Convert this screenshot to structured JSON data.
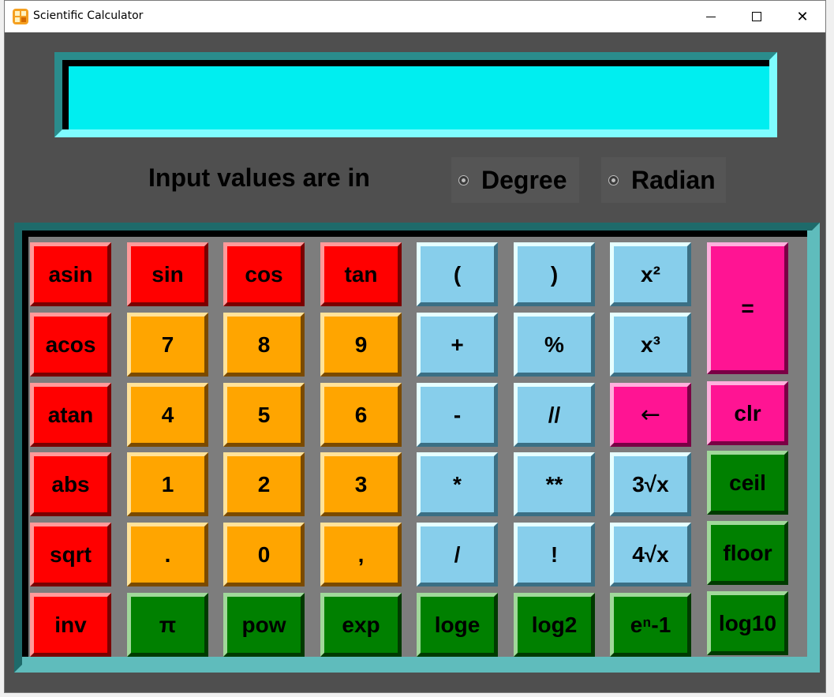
{
  "window": {
    "title": "Scientific Calculator"
  },
  "titlebar": {
    "min_icon": "minimize-icon",
    "max_icon": "maximize-icon",
    "close_glyph": "✕"
  },
  "display": {
    "value": ""
  },
  "mode": {
    "label": "Input values are in",
    "options": [
      "Degree",
      "Radian"
    ],
    "selected": null
  },
  "colors": {
    "red": "#ff0000",
    "orange": "#ffa500",
    "blue": "#87ceeb",
    "pink": "#ff1493",
    "green": "#008000",
    "display": "#00eef0",
    "background": "#4f4f4f"
  },
  "keys": {
    "asin": "asin",
    "sin": "sin",
    "cos": "cos",
    "tan": "tan",
    "lparen": "(",
    "rparen": ")",
    "square": "x²",
    "equals": "=",
    "acos": "acos",
    "n7": "7",
    "n8": "8",
    "n9": "9",
    "plus": "+",
    "percent": "%",
    "cube": "x³",
    "atan": "atan",
    "n4": "4",
    "n5": "5",
    "n6": "6",
    "minus": "-",
    "floordiv": "//",
    "backspace": "←",
    "clear": "clr",
    "abs": "abs",
    "n1": "1",
    "n2": "2",
    "n3": "3",
    "multiply": "*",
    "power_op": "**",
    "cube_root": "3√x",
    "ceil": "ceil",
    "sqrt": "sqrt",
    "dot": ".",
    "n0": "0",
    "comma": ",",
    "divide": "/",
    "factorial": "!",
    "fourth_root": "4√x",
    "floor": "floor",
    "inv": "inv",
    "pi": "π",
    "pow": "pow",
    "exp": "exp",
    "loge": "loge",
    "log2": "log2",
    "en1": "eⁿ-1",
    "log10": "log10"
  }
}
